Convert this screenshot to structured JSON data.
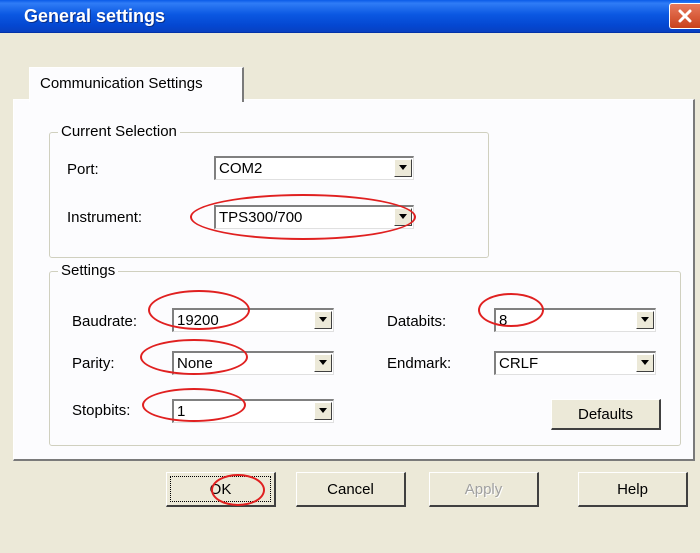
{
  "window": {
    "title": "General settings",
    "close_icon": "close-icon"
  },
  "tabs": [
    {
      "label": "Communication Settings"
    }
  ],
  "current_selection": {
    "legend": "Current Selection",
    "port_label": "Port:",
    "port_value": "COM2",
    "instrument_label": "Instrument:",
    "instrument_value": "TPS300/700"
  },
  "settings": {
    "legend": "Settings",
    "baudrate_label": "Baudrate:",
    "baudrate_value": "19200",
    "parity_label": "Parity:",
    "parity_value": "None",
    "stopbits_label": "Stopbits:",
    "stopbits_value": "1",
    "databits_label": "Databits:",
    "databits_value": "8",
    "endmark_label": "Endmark:",
    "endmark_value": "CRLF",
    "defaults_label": "Defaults"
  },
  "buttons": {
    "ok": "OK",
    "cancel": "Cancel",
    "apply": "Apply",
    "help": "Help"
  },
  "colors": {
    "title_bar": "#0a5be8",
    "annotation": "#e02020",
    "close_button": "#c9411b"
  }
}
